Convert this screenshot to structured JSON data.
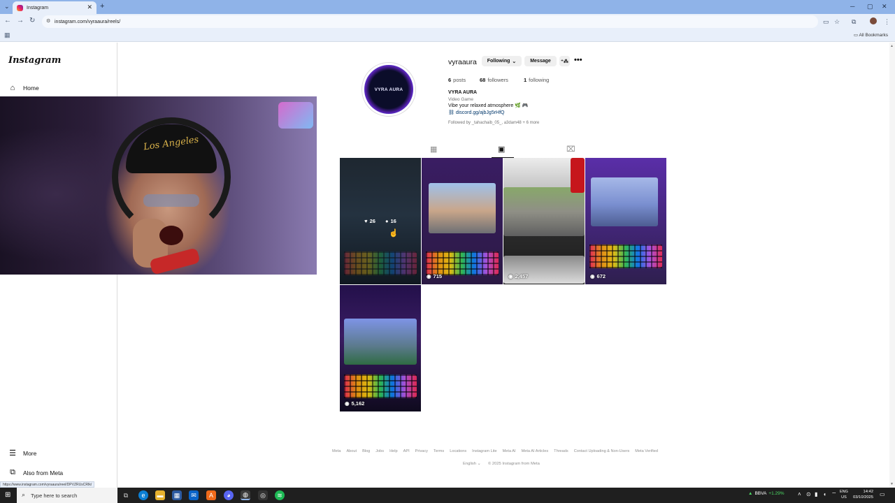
{
  "browser": {
    "tab_title": "Instagram",
    "tab_close": "✕",
    "new_tab": "+",
    "url": "instagram.com/vyraaura/reels/",
    "bookmarks_label": "All Bookmarks",
    "hover_url": "https://www.instagram.com/vyraaura/reel/DPVZRUsCRIk/"
  },
  "sidebar": {
    "logo": "Instagram",
    "home": "Home",
    "more": "More",
    "also_from_meta": "Also from Meta"
  },
  "profile": {
    "username": "vyraaura",
    "following_btn": "Following",
    "message_btn": "Message",
    "avatar_text": "VYRA AURA",
    "posts_count": "6",
    "posts_label": "posts",
    "followers_count": "68",
    "followers_label": "followers",
    "following_count": "1",
    "following_label": "following",
    "full_name": "VYRA AURA",
    "category": "Video Game",
    "bio": "Vibe your relaxed atmosphere 🌿 🎮",
    "link": "discord.gg/ajbJg5rHfQ",
    "followed_by": "Followed by _tahachaib_05_, a3dam48 + 6 more"
  },
  "reels": [
    {
      "views": "",
      "likes": "26",
      "comments": "16"
    },
    {
      "views": "715"
    },
    {
      "views": "2,457"
    },
    {
      "views": "672"
    },
    {
      "views": "5,162"
    }
  ],
  "webcam": {
    "cap_text": "Los Angeles"
  },
  "footer": {
    "links": [
      "Meta",
      "About",
      "Blog",
      "Jobs",
      "Help",
      "API",
      "Privacy",
      "Terms",
      "Locations",
      "Instagram Lite",
      "Meta AI",
      "Meta AI Articles",
      "Threads",
      "Contact Uploading & Non-Users",
      "Meta Verified"
    ],
    "language": "English",
    "copyright": "© 2025 Instagram from Meta"
  },
  "taskbar": {
    "search_placeholder": "Type here to search",
    "stock_name": "BBVA",
    "stock_change": "+1.29%",
    "lang_top": "ENG",
    "lang_bottom": "US",
    "time": "14:42",
    "date": "03/10/2025"
  }
}
